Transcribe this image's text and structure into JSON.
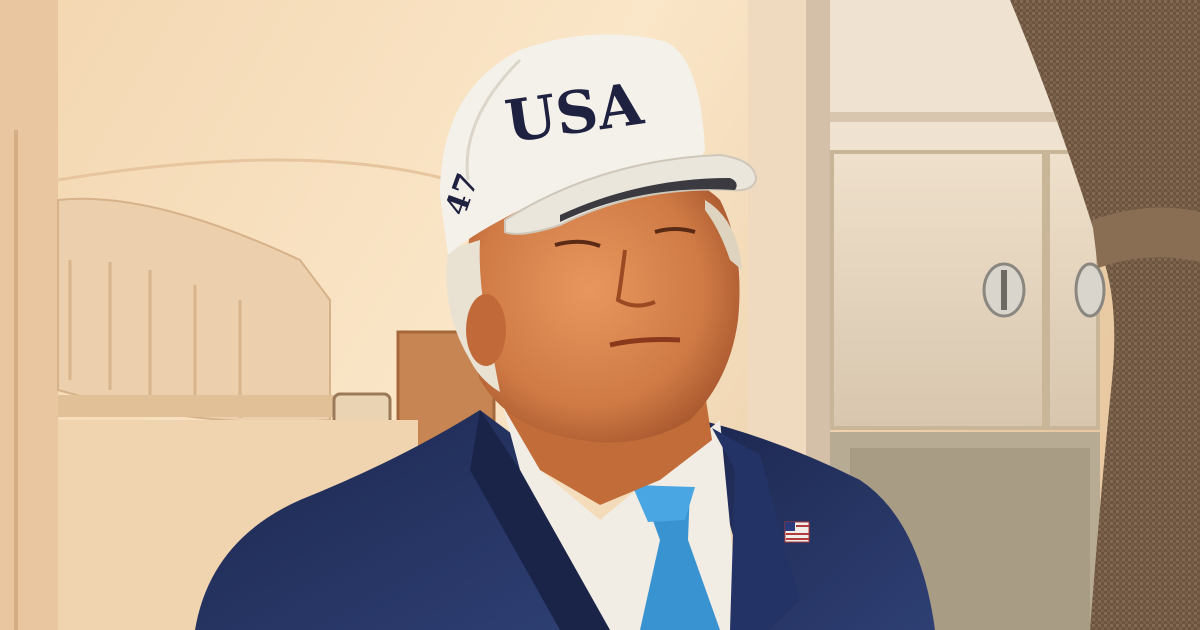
{
  "scene": {
    "cap_front_text": "USA",
    "cap_side_text": "47"
  },
  "colors": {
    "cabin_wall": "#efcfa8",
    "cabin_shadow": "#d9b48a",
    "cap_white": "#f4f1ea",
    "cap_text_navy": "#1f2140",
    "suit_navy": "#22305a",
    "shirt_white": "#f3efe6",
    "tie_blue": "#3a93d1",
    "curtain_brown": "#6b5440",
    "door_wood": "#c78a55",
    "cabinet_beige": "#e6d8c4"
  }
}
